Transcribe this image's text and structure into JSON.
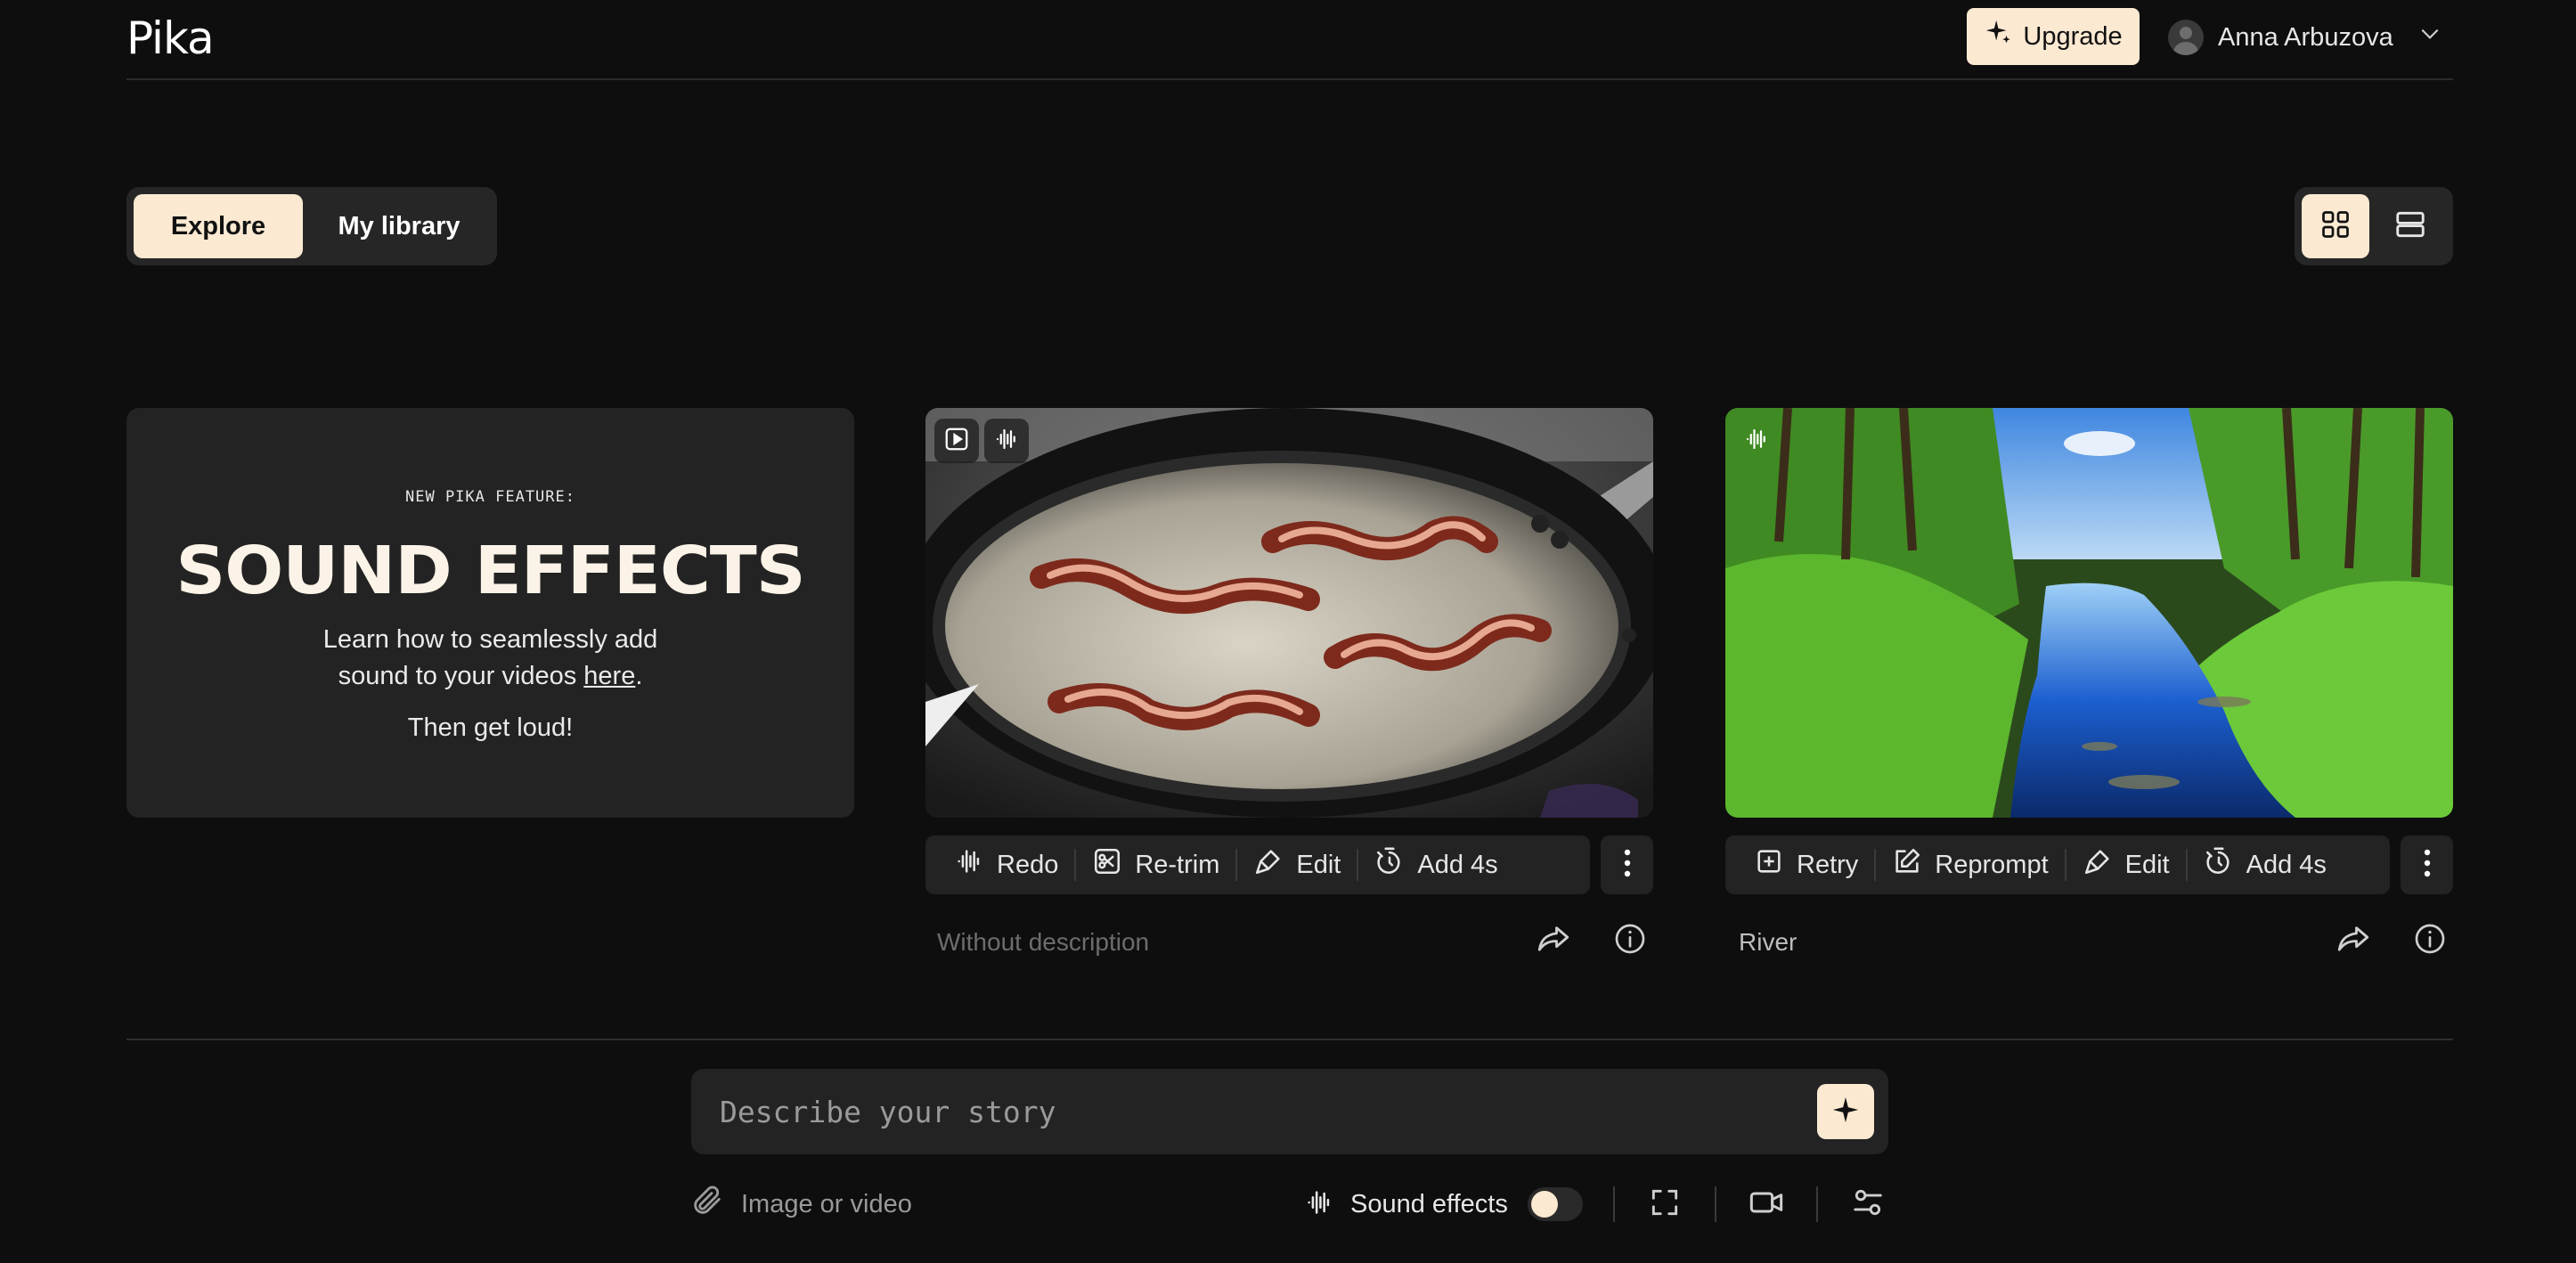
{
  "app": {
    "logo": "Pika"
  },
  "header": {
    "upgrade_label": "Upgrade",
    "user_name": "Anna Arbuzova",
    "accent": "#fbe9d2"
  },
  "tabs": [
    {
      "label": "Explore",
      "active": true
    },
    {
      "label": "My library",
      "active": false
    }
  ],
  "view_toggle": {
    "active": "grid-icon",
    "options": [
      "grid-icon",
      "list-icon"
    ]
  },
  "feature_card": {
    "kicker": "NEW PIKA FEATURE:",
    "title": "SOUND EFFECTS",
    "desc_line1": "Learn how to seamlessly add",
    "desc_line2_prefix": "sound to your videos ",
    "desc_link": "here",
    "desc_line2_suffix": ".",
    "tagline": "Then get loud!"
  },
  "videos": [
    {
      "badges": [
        "play-icon",
        "waveform-icon"
      ],
      "actions": [
        {
          "icon": "waveform-icon",
          "label": "Redo"
        },
        {
          "icon": "scissors-icon",
          "label": "Re-trim"
        },
        {
          "icon": "brush-icon",
          "label": "Edit"
        },
        {
          "icon": "timer-icon",
          "label": "Add 4s"
        }
      ],
      "description": "Without description",
      "description_muted": true
    },
    {
      "badges": [
        "waveform-icon"
      ],
      "actions": [
        {
          "icon": "retry-icon",
          "label": "Retry"
        },
        {
          "icon": "pencil-icon",
          "label": "Reprompt"
        },
        {
          "icon": "brush-icon",
          "label": "Edit"
        },
        {
          "icon": "timer-icon",
          "label": "Add 4s"
        }
      ],
      "description": "River",
      "description_muted": false
    }
  ],
  "composer": {
    "placeholder": "Describe your story",
    "attach_label": "Image or video",
    "sound_effects_label": "Sound effects",
    "sound_effects_on": false
  }
}
